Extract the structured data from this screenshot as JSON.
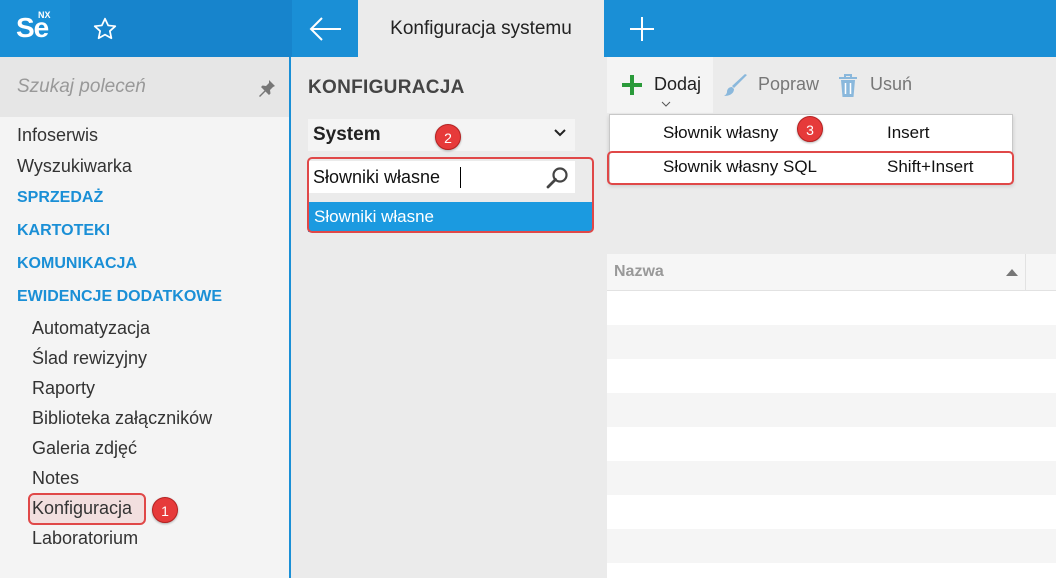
{
  "app": {
    "logo_text": "Se",
    "logo_superscript": "NX"
  },
  "tabs": {
    "active_title": "Konfiguracja systemu"
  },
  "leftnav": {
    "search_placeholder": "Szukaj poleceń",
    "items": [
      "Infoserwis",
      "Wyszukiwarka"
    ],
    "sections": [
      "SPRZEDAŻ",
      "KARTOTEKI",
      "KOMUNIKACJA",
      "EWIDENCJE DODATKOWE"
    ],
    "subitems": [
      "Automatyzacja",
      "Ślad rewizyjny",
      "Raporty",
      "Biblioteka załączników",
      "Galeria zdjęć",
      "Notes",
      "Konfiguracja",
      "Laboratorium"
    ]
  },
  "middle": {
    "title": "KONFIGURACJA",
    "select_value": "System",
    "filter_value": "Słowniki własne",
    "result_item": "Słowniki własne"
  },
  "toolbar": {
    "add_label": "Dodaj",
    "edit_label": "Popraw",
    "delete_label": "Usuń"
  },
  "dropdown": {
    "items": [
      {
        "name": "Słownik własny",
        "shortcut": "Insert"
      },
      {
        "name": "Słownik własny SQL",
        "shortcut": "Shift+Insert"
      }
    ]
  },
  "grid": {
    "column_header": "Nazwa"
  },
  "badges": [
    "1",
    "2",
    "3"
  ],
  "colors": {
    "brand": "#1a8fd6",
    "selection": "#1b9ae0",
    "annotation": "#e04848",
    "add_green": "#2a9a3a"
  }
}
